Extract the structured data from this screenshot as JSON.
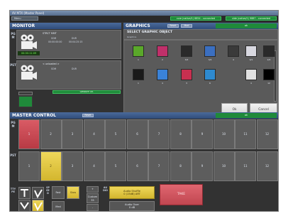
{
  "window": {
    "title": "AV MTX (Master Panel)"
  },
  "toolbar": {
    "menu_label": "Menu",
    "connections": [
      "core (native/1) 8854 - connected",
      "vide (native/1) 9887 - connected"
    ]
  },
  "monitor": {
    "title": "MONITOR",
    "pgm_label": "PGM",
    "pst_label": "PST",
    "pgm": {
      "name": "STRCT MMT",
      "som_label": "SOM",
      "som_value": "00:00:00:00",
      "dur_label": "DUR",
      "dur_value": "00:04:25:15",
      "timecode": "00:00:11:09"
    },
    "pst": {
      "name": "< unloaded >",
      "som_label": "SOM",
      "dur_label": "DUR"
    },
    "status": "Gesture OK"
  },
  "graphics": {
    "title": "GRAPHICS",
    "buttons": [
      "Reset",
      "Mod"
    ],
    "status": "ok",
    "select_title": "SELECT GRAPHIC OBJECT",
    "subtitle": "Graphics",
    "items": [
      {
        "label": "1",
        "color": "#5aa82a"
      },
      {
        "label": "2",
        "color": "#c0306a"
      },
      {
        "label": "3/2",
        "color": "#2a2a2a"
      },
      {
        "label": "3/4",
        "color": "#3b6fc0"
      },
      {
        "label": "4",
        "color": "#3a3a3a"
      },
      {
        "label": "9/1",
        "color": "#d8d8e0"
      },
      {
        "label": "2/4",
        "color": "#2a2a2a"
      },
      {
        "label": "1",
        "color": "#1a1a1a"
      },
      {
        "label": "4",
        "color": "#3a82d8"
      },
      {
        "label": "3",
        "color": "#c83050"
      },
      {
        "label": "6",
        "color": "#2e8ad0"
      },
      {
        "label": "4",
        "color": "#e0e0e0"
      },
      {
        "label": "12",
        "color": "#000000"
      }
    ],
    "ok_label": "Ok",
    "cancel_label": "Cancel"
  },
  "master_control": {
    "title": "MASTER CONTROL",
    "title_button": "Reset",
    "status": "ok",
    "pgm_label": "PGM",
    "pst_label": "PST",
    "pgm_buttons": [
      "1",
      "2",
      "3",
      "4",
      "5",
      "6",
      "7",
      "8",
      "9",
      "10",
      "11",
      "12"
    ],
    "pst_buttons": [
      "1",
      "2",
      "3",
      "4",
      "5",
      "6",
      "7",
      "8",
      "9",
      "10",
      "11",
      "12"
    ],
    "pgm_active": 0,
    "pst_active": 1,
    "trans_type_label": "TTYPE",
    "speed_label": "SPEED",
    "audio_label": "AUDIO",
    "fast_label": "Fast",
    "slow_label": "Slow",
    "med_label": "Med",
    "custom_label": "Custom",
    "custom_value": "35",
    "stepper_up": "+",
    "stepper_down": "-",
    "audio_shuffle": "Audio Shuffle",
    "audio_shuffle_value": "0 (15dB) ART",
    "audio_over": "Audio Over",
    "audio_over_value": "0 dB",
    "take_label": "TAKE"
  }
}
